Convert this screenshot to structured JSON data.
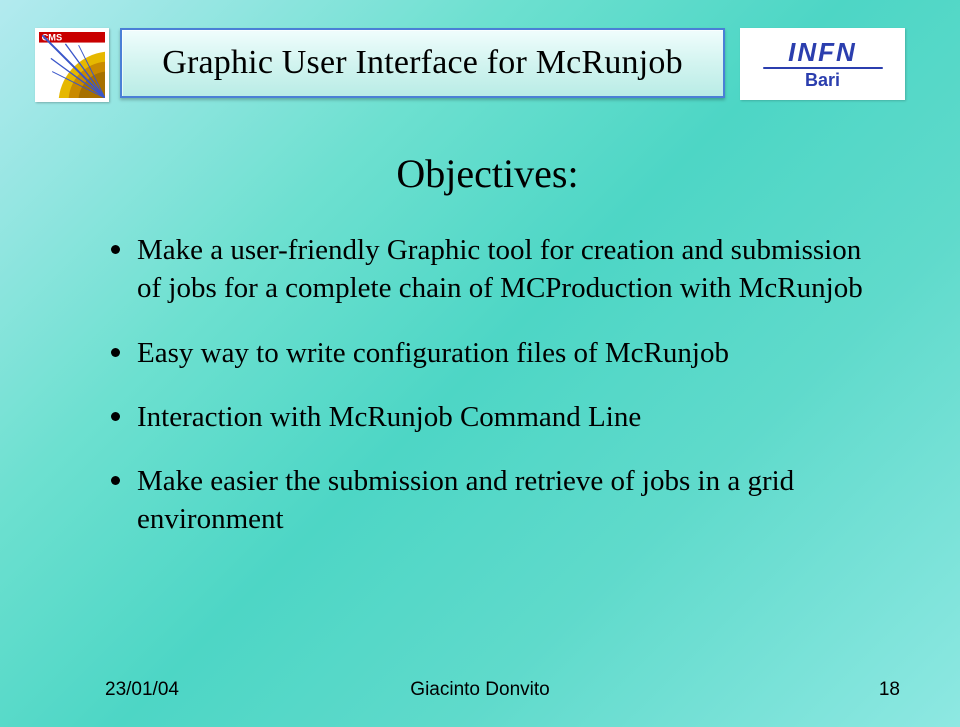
{
  "logos": {
    "cms_label": "CMS",
    "infn_word": "INFN",
    "infn_sub": "Bari"
  },
  "title": "Graphic User Interface for McRunjob",
  "heading": "Objectives:",
  "bullets": [
    "Make a user-friendly Graphic tool for creation and submission of jobs for a complete chain of MCProduction with McRunjob",
    "Easy way to write configuration files of McRunjob",
    "Interaction with McRunjob Command Line",
    "Make easier the submission and retrieve of jobs in a grid environment"
  ],
  "footer": {
    "date": "23/01/04",
    "author": "Giacinto Donvito",
    "page": "18"
  }
}
